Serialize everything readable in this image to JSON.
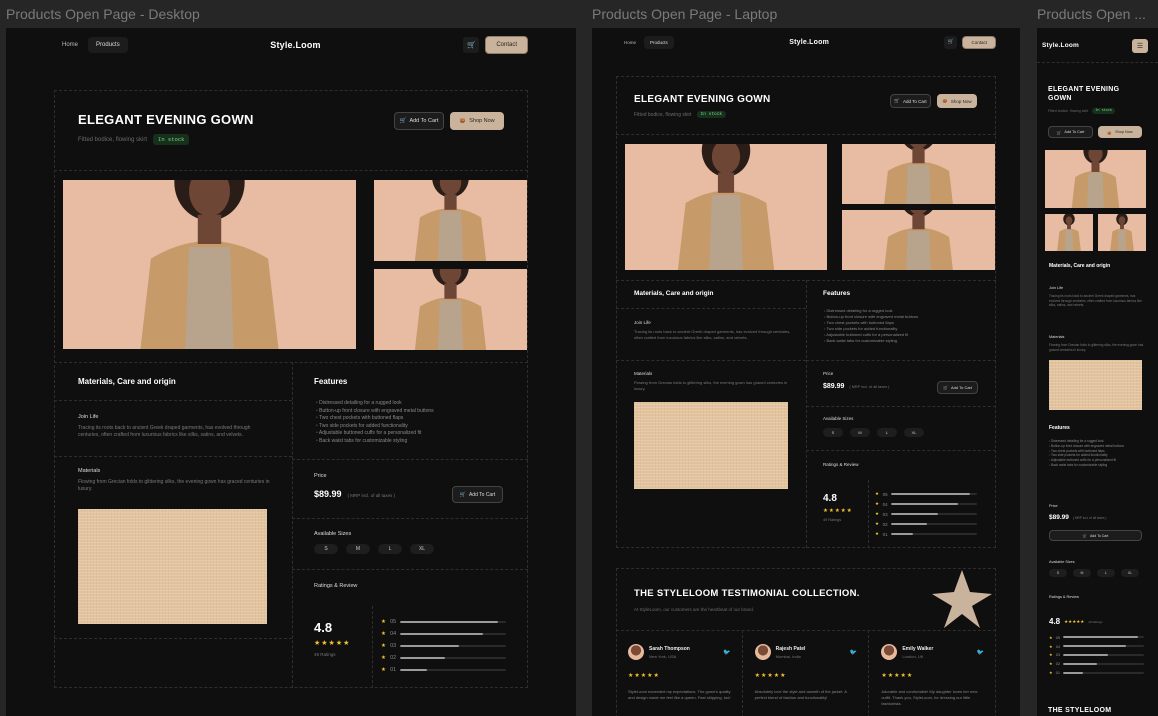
{
  "frames": {
    "desktop_label": "Products Open Page - Desktop",
    "laptop_label": "Products Open Page - Laptop",
    "mobile_label": "Products Open ..."
  },
  "nav": {
    "home": "Home",
    "products": "Products",
    "brand": "Style.Loom",
    "contact": "Contact"
  },
  "product": {
    "title": "ELEGANT EVENING GOWN",
    "subtitle": "Fitted bodice, flowing skirt",
    "stock": "In stock",
    "add_to_cart": "Add To Cart",
    "shop_now": "Shop Now"
  },
  "details": {
    "materials_heading": "Materials, Care and origin",
    "join_life_title": "Join Life",
    "join_life_text": "Tracing its roots back to ancient Greek draped garments, has evolved through centuries, often crafted from luxurious fabrics like silks, satins, and velvets.",
    "materials_title": "Materials",
    "materials_text": "Flowing from Grecian folds to glittering silks, the evening gown has graced centuries in luxury."
  },
  "features": {
    "heading": "Features",
    "items": [
      "Distressed detailing for a rugged look",
      "Button-up front closure with engraved metal buttons",
      "Two chest pockets with buttoned flaps",
      "Two side pockets for added functionality",
      "Adjustable buttoned cuffs for a personalized fit",
      "Back waist tabs for customizable styling"
    ]
  },
  "price": {
    "label": "Price",
    "value": "$89.99",
    "note": "( MRP incl. of all taxes )",
    "add_to_cart": "Add To Cart"
  },
  "sizes": {
    "label": "Available Sizes",
    "items": [
      "S",
      "M",
      "L",
      "XL"
    ]
  },
  "ratings": {
    "label": "Ratings & Review",
    "score": "4.8",
    "stars": "★★★★★",
    "count": "49 Ratings",
    "rows": [
      {
        "label": "05",
        "fill": 0.92
      },
      {
        "label": "04",
        "fill": 0.78
      },
      {
        "label": "03",
        "fill": 0.55
      },
      {
        "label": "02",
        "fill": 0.42
      },
      {
        "label": "01",
        "fill": 0.25
      }
    ]
  },
  "testimonials": {
    "title": "THE STYLELOOM TESTIMONIAL COLLECTION.",
    "subtitle": "At StyleLoom, our customers are the heartbeat of our brand.",
    "mobile_title": "THE STYLELOOM",
    "items": [
      {
        "name": "Sarah Thompson",
        "location": "New York, USA",
        "stars": "★★★★★",
        "text": "StyleLoom exceeded my expectations. The gown's quality and design made me feel like a queen. Fast shipping, too!"
      },
      {
        "name": "Rajesh Patel",
        "location": "Mumbai, India",
        "stars": "★★★★★",
        "text": "Absolutely love the style and warmth of the jacket. A perfect blend of fashion and functionality!"
      },
      {
        "name": "Emily Walker",
        "location": "London, UK",
        "stars": "★★★★★",
        "text": "Adorable and comfortable! My daughter loves her new outfit. Thank you, StyleLoom, for dressing our little fashionista."
      }
    ]
  },
  "colors": {
    "accent": "#c9b39d",
    "background": "#0f0f0f",
    "stock": "#7cd48a",
    "star": "#f2c230"
  },
  "icons": [
    "cart-icon",
    "bag-icon",
    "twitter-icon",
    "menu-icon"
  ]
}
